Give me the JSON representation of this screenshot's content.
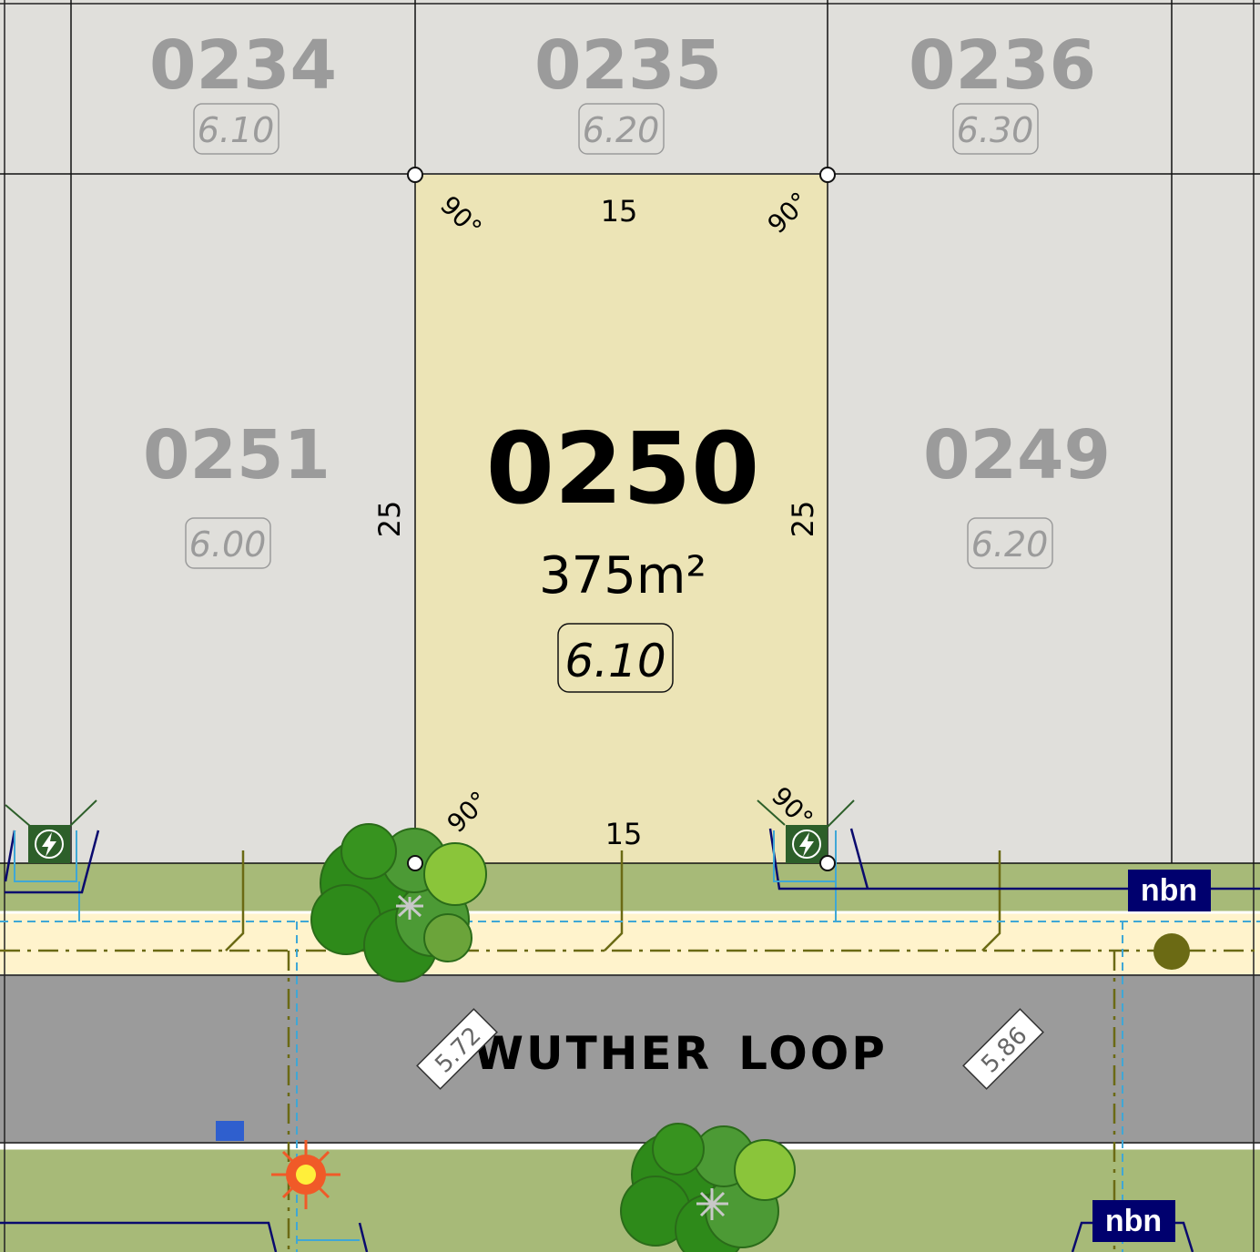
{
  "lots": {
    "l0234": {
      "number": "0234",
      "rl": "6.10"
    },
    "l0235": {
      "number": "0235",
      "rl": "6.20"
    },
    "l0236": {
      "number": "0236",
      "rl": "6.30"
    },
    "l0251": {
      "number": "0251",
      "rl": "6.00"
    },
    "l0249": {
      "number": "0249",
      "rl": "6.20"
    },
    "l0250": {
      "number": "0250",
      "area": "375m²",
      "rl": "6.10",
      "fill_color": "#ece4b6"
    }
  },
  "dimensions": {
    "top_frontage": "15",
    "bottom_frontage": "15",
    "left_depth": "25",
    "right_depth": "25",
    "angle_top_left": "90°",
    "angle_top_right": "90°",
    "angle_bottom_left": "90°",
    "angle_bottom_right": "90°"
  },
  "road": {
    "name_part1": "WUTHER",
    "name_part2": "LOOP",
    "level_left": "5.72",
    "level_right": "5.86"
  },
  "services": {
    "nbn_label_1": "nbn",
    "nbn_label_2": "nbn",
    "power_pillar_icon": "lightning-bolt-icon",
    "street_light_icon": "sun-icon",
    "tree_icon": "tree-canopy-icon"
  },
  "colors": {
    "neighbour_lot": "#e0dfdb",
    "subject_lot": "#ece4b6",
    "verge": "#a7ba78",
    "footpath": "#fff3cc",
    "road": "#9b9b9b",
    "nbn_badge": "#00006e",
    "pillar": "#2d5f2a",
    "sewer_line": "#6b6a14",
    "water_line": "#3fa7d6"
  }
}
